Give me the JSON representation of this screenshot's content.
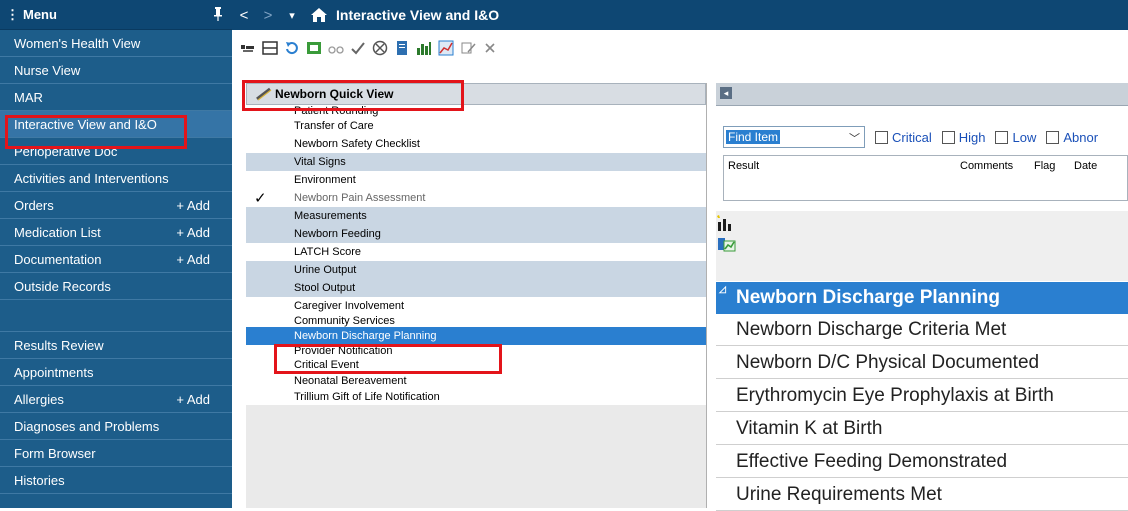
{
  "sidebar": {
    "title": "Menu",
    "items": [
      {
        "label": "Women's Health View"
      },
      {
        "label": "Nurse View"
      },
      {
        "label": "MAR"
      },
      {
        "label": "Interactive View and I&O"
      },
      {
        "label": "Perioperative Doc"
      },
      {
        "label": "Activities and Interventions"
      },
      {
        "label": "Orders",
        "add": "+ Add"
      },
      {
        "label": "Medication List",
        "add": "+ Add"
      },
      {
        "label": "Documentation",
        "add": "+ Add"
      },
      {
        "label": "Outside Records"
      }
    ],
    "items2": [
      {
        "label": "Results Review"
      },
      {
        "label": "Appointments"
      },
      {
        "label": "Allergies",
        "add": "+ Add"
      },
      {
        "label": "Diagnoses and Problems"
      },
      {
        "label": "Form Browser"
      },
      {
        "label": "Histories"
      }
    ]
  },
  "topbar": {
    "back": "<",
    "forward": ">",
    "dropdown": "▾",
    "title": "Interactive View and I&O"
  },
  "quickview": {
    "title": "Newborn Quick View",
    "items": [
      "Patient Rounding",
      "Transfer of Care",
      "Newborn Safety Checklist",
      "Vital Signs",
      "Environment",
      "Newborn Pain Assessment",
      "Measurements",
      "Newborn Feeding",
      "LATCH Score",
      "Urine Output",
      "Stool Output",
      "Caregiver Involvement",
      "Community Services",
      "Newborn Discharge Planning",
      "Provider Notification",
      "Critical Event",
      "Neonatal Bereavement",
      "Trillium Gift of Life Notification"
    ],
    "check_mark": "✓"
  },
  "right": {
    "find_item": "Find Item",
    "filters": [
      "Critical",
      "High",
      "Low",
      "Abnor"
    ],
    "result_headers": [
      "Result",
      "Comments",
      "Flag",
      "Date"
    ],
    "section_title": "Newborn Discharge Planning",
    "rows": [
      "Newborn Discharge Criteria Met",
      "Newborn D/C  Physical Documented",
      "Erythromycin Eye Prophylaxis at Birth",
      "Vitamin K at Birth",
      "Effective Feeding Demonstrated",
      "Urine Requirements Met"
    ]
  },
  "colors": {
    "highlight": "#e3141a",
    "nav_bg": "#1d5d8a",
    "selected": "#2a7fd0"
  }
}
